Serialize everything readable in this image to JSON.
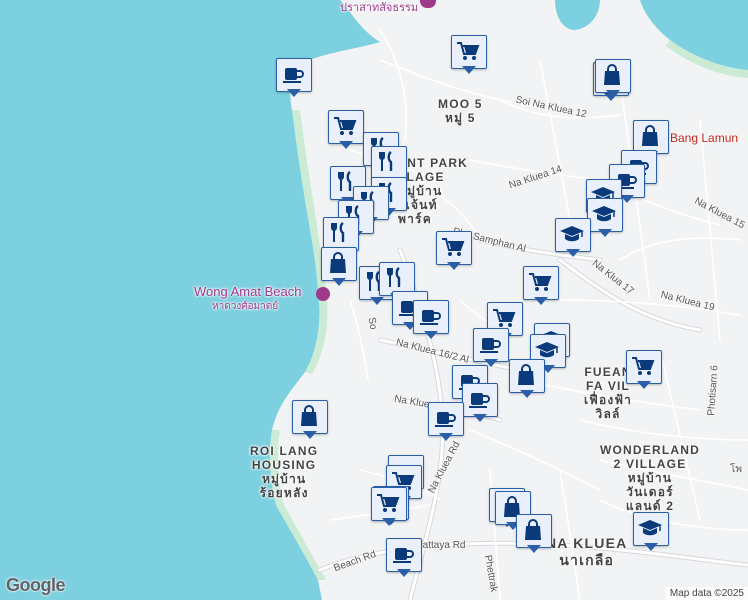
{
  "map": {
    "colors": {
      "water": "#7dd0df",
      "land": "#f1f3f4",
      "road": "#ffffff",
      "road_edge": "#d6d8dc",
      "beach": "#ccebd5",
      "pin_border": "#2a5fa8",
      "pin_fill": "#e9f0fb"
    },
    "labels": {
      "moo5_en": "MOO 5",
      "moo5_th": "หมู่ 5",
      "regent_en_1": "ENT PARK",
      "regent_en_2": "LLAGE",
      "regent_th_1": "หมู่บ้าน",
      "regent_th_2": "รีเจ้นท์",
      "regent_th_3": "พาร์ค",
      "fuean_en_1": "FUEAN",
      "fuean_en_2": "FA VIL",
      "fuean_th_1": "เฟื่องฟ้า",
      "fuean_th_2": "วิลล์",
      "roi_en_1": "ROI LANG",
      "roi_en_2": "HOUSING",
      "roi_th_1": "หมู่บ้าน",
      "roi_th_2": "ร้อยหลัง",
      "wonder_en_1": "WONDERLAND",
      "wonder_en_2": "2 VILLAGE",
      "wonder_th_1": "หมู่บ้าน",
      "wonder_th_2": "วันเดอร์",
      "wonder_th_3": "แลนด์ 2",
      "na_kluea_en": "NA KLUEA",
      "na_kluea_th": "นาเกลือ",
      "bang_lamung": "Bang Lamun",
      "sanctuary_th": "ปราสาทสัจธรรม",
      "wong_amat_en": "Wong Amat Beach",
      "wong_amat_th": "หาดวงศ์อมาตย์",
      "soi_na_kluea_12": "Soi Na Kluea 12",
      "na_kluea_14": "Na Kluea 14",
      "na_kluea_15": "Na Kluea 15",
      "na_kluea_17": "Na Klua 17",
      "na_kluea_19": "Na Kluea 19",
      "na_kluea_16_2": "Na Kluea 16/2 Al",
      "na_kluea_rd": "Na Kluea",
      "na_kluea_rd_2": "Na Kluea Rd",
      "pho_samphan": "Pho Samphan Al",
      "photisarn_6": "Photisarn 6",
      "n_pattaya_rd": "N Pattaya Rd",
      "beach_rd": "Beach Rd",
      "phettrak": "Phettrak",
      "soi_s": "So",
      "edge_1": "โพ"
    },
    "attribution": "Map data ©2025",
    "logo": "Google"
  },
  "pins": [
    {
      "icon": "cafe"
    },
    {
      "icon": "cart"
    },
    {
      "icon": "school"
    },
    {
      "icon": "bag"
    },
    {
      "icon": "cart"
    },
    {
      "icon": "bag"
    },
    {
      "icon": "restaurant"
    },
    {
      "icon": "restaurant"
    },
    {
      "icon": "restaurant"
    },
    {
      "icon": "cafe"
    },
    {
      "icon": "cafe"
    },
    {
      "icon": "school"
    },
    {
      "icon": "restaurant"
    },
    {
      "icon": "restaurant"
    },
    {
      "icon": "restaurant"
    },
    {
      "icon": "school"
    },
    {
      "icon": "cart"
    },
    {
      "icon": "school"
    },
    {
      "icon": "restaurant"
    },
    {
      "icon": "bag"
    },
    {
      "icon": "cart"
    },
    {
      "icon": "restaurant"
    },
    {
      "icon": "restaurant"
    },
    {
      "icon": "cafe"
    },
    {
      "icon": "cafe"
    },
    {
      "icon": "cart"
    },
    {
      "icon": "school"
    },
    {
      "icon": "cafe"
    },
    {
      "icon": "school"
    },
    {
      "icon": "cart"
    },
    {
      "icon": "cafe"
    },
    {
      "icon": "bag"
    },
    {
      "icon": "cafe"
    },
    {
      "icon": "cafe"
    },
    {
      "icon": "bag"
    },
    {
      "icon": "cafe"
    },
    {
      "icon": "cart"
    },
    {
      "icon": "cart"
    },
    {
      "icon": "bag"
    },
    {
      "icon": "bag"
    },
    {
      "icon": "school"
    },
    {
      "icon": "bag"
    },
    {
      "icon": "cafe"
    },
    {
      "icon": "cart"
    }
  ]
}
